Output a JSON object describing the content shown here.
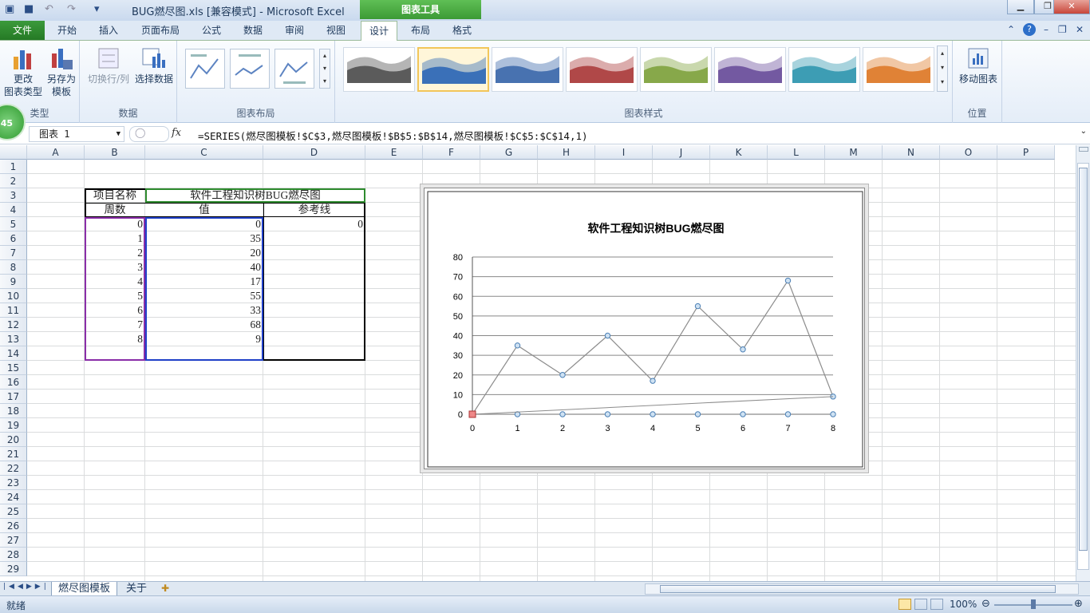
{
  "window": {
    "title": "BUG燃尽图.xls  [兼容模式]  -  Microsoft Excel",
    "context_tab": "图表工具"
  },
  "tabs": [
    "文件",
    "开始",
    "插入",
    "页面布局",
    "公式",
    "数据",
    "审阅",
    "视图",
    "设计",
    "布局",
    "格式"
  ],
  "ribbon": {
    "groups": [
      {
        "label": "类型",
        "buttons": [
          "更改\n图表类型",
          "另存为\n模板"
        ]
      },
      {
        "label": "数据",
        "buttons": [
          "切换行/列",
          "选择数据"
        ]
      },
      {
        "label": "图表布局"
      },
      {
        "label": "图表样式"
      },
      {
        "label": "位置",
        "buttons": [
          "移动图表"
        ]
      }
    ],
    "style_colors": [
      "#5b5b5b",
      "#3a70b8",
      "#4872b0",
      "#b04848",
      "#87a84a",
      "#7359a1",
      "#3d9db4",
      "#e08236"
    ],
    "selected_style": 1
  },
  "formula_bar": {
    "name_box": "图表 1",
    "fx": "fx",
    "formula": "=SERIES(燃尽图模板!$C$3,燃尽图模板!$B$5:$B$14,燃尽图模板!$C$5:$C$14,1)"
  },
  "badge": "45",
  "columns": [
    "A",
    "B",
    "C",
    "D",
    "E",
    "F",
    "G",
    "H",
    "I",
    "J",
    "K",
    "L",
    "M",
    "N",
    "O",
    "P"
  ],
  "rows": [
    "1",
    "2",
    "3",
    "4",
    "5",
    "6",
    "7",
    "8",
    "9",
    "10",
    "11",
    "12",
    "13",
    "14",
    "15",
    "16",
    "17",
    "18",
    "19",
    "20",
    "21",
    "22",
    "23",
    "24",
    "25",
    "26",
    "27",
    "28",
    "29"
  ],
  "sheet": {
    "project_label": "项目名称",
    "project_name": "软件工程知识树BUG燃尽图",
    "headers": [
      "周数",
      "值",
      "参考线"
    ],
    "weeks": [
      "0",
      "1",
      "2",
      "3",
      "4",
      "5",
      "6",
      "7",
      "8"
    ],
    "values": [
      "0",
      "35",
      "20",
      "40",
      "17",
      "55",
      "33",
      "68",
      "9"
    ],
    "reference": [
      "0"
    ]
  },
  "sheet_tabs": [
    "燃尽图模板",
    "关于"
  ],
  "status": {
    "ready": "就绪",
    "zoom": "100%"
  },
  "chart_data": {
    "type": "line",
    "title": "软件工程知识树BUG燃尽图",
    "x": [
      0,
      1,
      2,
      3,
      4,
      5,
      6,
      7,
      8
    ],
    "series": [
      {
        "values": [
          0,
          35,
          20,
          40,
          17,
          55,
          33,
          68,
          9
        ]
      },
      {
        "values": [
          0,
          0,
          0,
          0,
          0,
          0,
          0,
          0,
          0
        ]
      }
    ],
    "ylim": [
      0,
      80
    ],
    "yticks": [
      0,
      10,
      20,
      30,
      40,
      50,
      60,
      70,
      80
    ],
    "xlim": [
      0,
      8
    ],
    "grid": true,
    "legend": "none"
  }
}
